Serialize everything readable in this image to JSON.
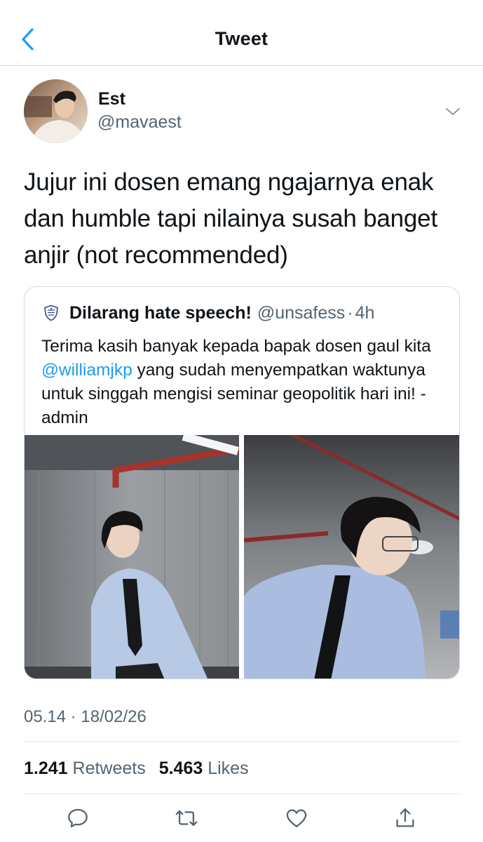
{
  "header": {
    "title": "Tweet",
    "back_icon": "chevron-left-icon"
  },
  "author": {
    "display_name": "Est",
    "handle": "@mavaest",
    "more_icon": "chevron-down-icon"
  },
  "tweet": {
    "text": "Jujur ini dosen emang ngajarnya enak dan humble tapi nilainya susah banget anjir (not recommended)"
  },
  "quoted_tweet": {
    "name": "Dilarang hate speech!",
    "handle": "@unsafess",
    "separator": "·",
    "time": "4h",
    "text_before": "Terima kasih banyak kepada bapak dosen gaul kita ",
    "mention": "@williamjkp",
    "text_after": " yang sudah menyempatkan waktunya untuk singgah mengisi seminar geopolitik hari ini! -admin",
    "photo_count": 2
  },
  "meta": {
    "timestamp": "05.14 · 18/02/26",
    "retweets_count": "1.241",
    "retweets_label": "Retweets",
    "likes_count": "5.463",
    "likes_label": "Likes"
  },
  "actions": [
    "reply-icon",
    "retweet-icon",
    "like-icon",
    "share-icon"
  ],
  "colors": {
    "accent": "#1d9bf0",
    "text_primary": "#0f1419",
    "text_secondary": "#536471",
    "border": "#cfd9de"
  }
}
